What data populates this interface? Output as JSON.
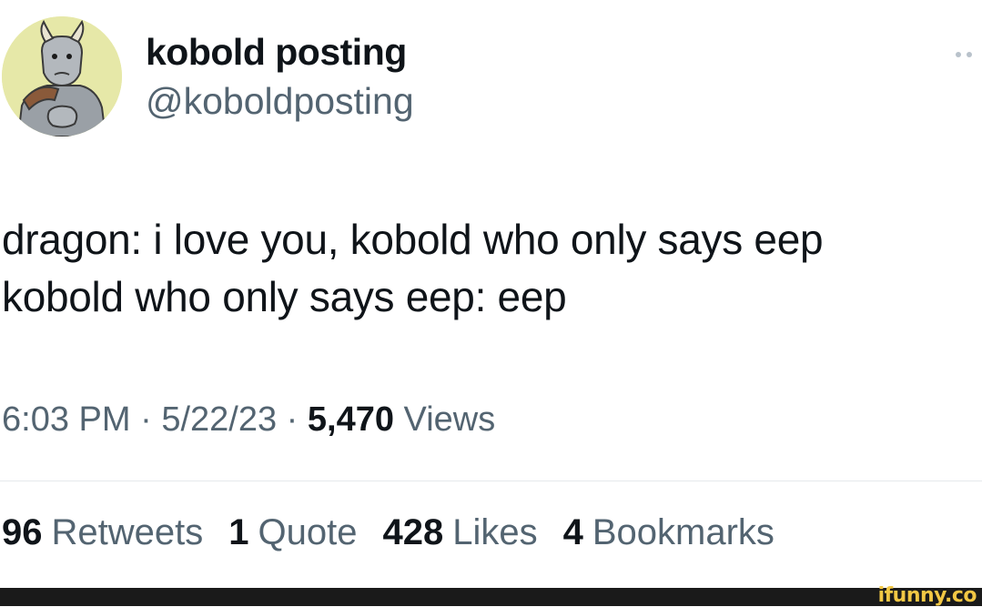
{
  "author": {
    "display_name": "kobold posting",
    "handle": "@koboldposting",
    "avatar_icon": "kobold-avatar",
    "avatar_bg": "#e6e8a8"
  },
  "tweet": {
    "lines": [
      "dragon: i love you, kobold who only says eep",
      "kobold who only says eep: eep"
    ]
  },
  "meta": {
    "time": "6:03 PM",
    "separator": "·",
    "date": "5/22/23",
    "views_count": "5,470",
    "views_label": "Views"
  },
  "stats": {
    "retweets": {
      "count": "96",
      "label": "Retweets"
    },
    "quotes": {
      "count": "1",
      "label": "Quote"
    },
    "likes": {
      "count": "428",
      "label": "Likes"
    },
    "bookmarks": {
      "count": "4",
      "label": "Bookmarks"
    }
  },
  "watermark": {
    "text": "ifunny.co",
    "color": "#f2c744"
  },
  "colors": {
    "text_primary": "#0f1419",
    "text_secondary": "#536471",
    "divider": "#e6e9ec"
  }
}
